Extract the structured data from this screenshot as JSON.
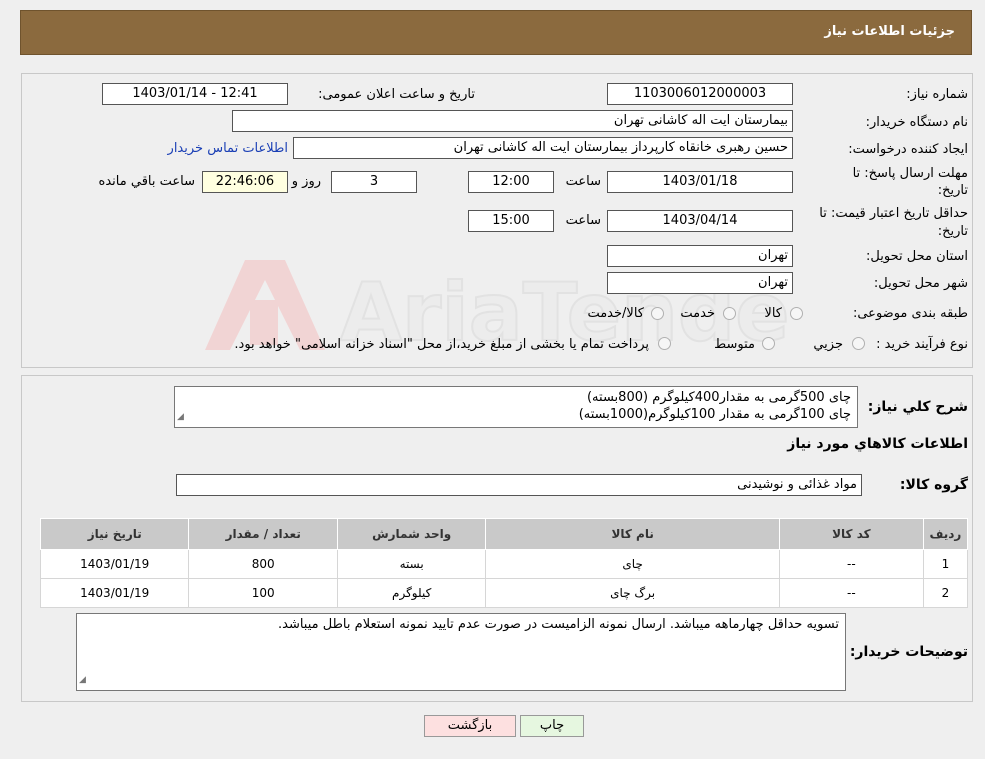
{
  "header": {
    "title": "جزئیات اطلاعات نیاز"
  },
  "fields": {
    "need_number_label": "شماره نیاز:",
    "need_number": "1103006012000003",
    "announce_label": "تاریخ و ساعت اعلان عمومی:",
    "announce_value": "1403/01/14 - 12:41",
    "buyer_org_label": "نام دستگاه خریدار:",
    "buyer_org": "بیمارستان ایت اله کاشانی تهران",
    "requester_label": "ایجاد کننده درخواست:",
    "requester": "حسین رهبری خانقاه کارپرداز بیمارستان ایت اله کاشانی تهران",
    "contact_link": "اطلاعات تماس خریدار",
    "deadline_label_line1": "مهلت ارسال پاسخ: تا",
    "deadline_label_line2": "تاریخ:",
    "deadline_date": "1403/01/18",
    "hour_label": "ساعت",
    "deadline_time": "12:00",
    "days_value": "3",
    "days_label": "روز و",
    "remaining_time": "22:46:06",
    "remaining_label": "ساعت باقي مانده",
    "validity_label_line1": "حداقل تاریخ اعتبار قیمت: تا",
    "validity_label_line2": "تاریخ:",
    "validity_date": "1403/04/14",
    "validity_time": "15:00",
    "province_label": "استان محل تحویل:",
    "province": "تهران",
    "city_label": "شهر محل تحویل:",
    "city": "تهران",
    "category_label": "طبقه بندی موضوعی:",
    "category_options": [
      "کالا",
      "خدمت",
      "کالا/خدمت"
    ],
    "process_label": "نوع فرآیند خرید :",
    "process_options": [
      "جزیي",
      "متوسط"
    ],
    "payment_note": "پرداخت تمام یا بخشی از مبلغ خرید،از محل \"اسناد خزانه اسلامی\" خواهد بود."
  },
  "description": {
    "label": "شرح کلي نياز:",
    "line1": "چای 500گرمی به مقدار400کیلوگرم (800بسته)",
    "line2": "چای 100گرمی به مقدار 100کیلوگرم(1000بسته)"
  },
  "goods": {
    "section_title": "اطلاعات كالاهاي مورد نياز",
    "group_label": "گروه کالا:",
    "group_value": "مواد غذائی و نوشیدنی",
    "columns": [
      "رديف",
      "کد کالا",
      "نام کالا",
      "واحد شمارش",
      "تعداد / مقدار",
      "تاریخ نیاز"
    ],
    "rows": [
      {
        "index": "1",
        "code": "--",
        "name": "چای",
        "unit": "بسته",
        "qty": "800",
        "date": "1403/01/19"
      },
      {
        "index": "2",
        "code": "--",
        "name": "برگ چای",
        "unit": "کیلوگرم",
        "qty": "100",
        "date": "1403/01/19"
      }
    ]
  },
  "buyer_notes": {
    "label": "توضیحات خریدار:",
    "text": "تسویه حداقل چهارماهه میباشد. ارسال نمونه الزامیست در صورت عدم تایید نمونه استعلام باطل میباشد."
  },
  "buttons": {
    "print": "چاپ",
    "back": "بازگشت"
  },
  "colors": {
    "header_bg": "#8b6a3e",
    "link": "#1a3fb5",
    "back_btn_bg": "#fde0e0",
    "print_btn_bg": "#e6f7e0"
  }
}
